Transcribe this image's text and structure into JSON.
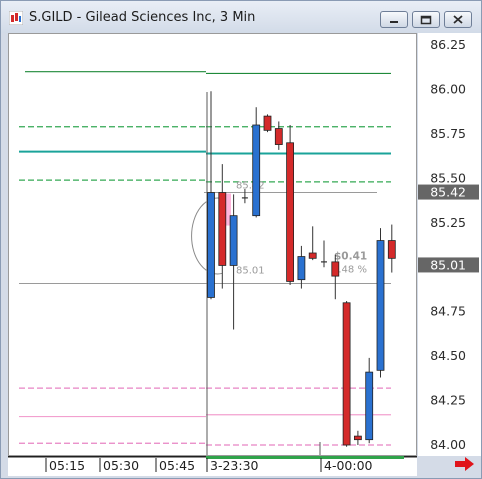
{
  "window": {
    "title": "S.GILD - Gilead Sciences Inc, 3 Min",
    "buttons": [
      "minimize",
      "restore",
      "close"
    ]
  },
  "chart_data": {
    "type": "candlestick",
    "symbol": "S.GILD",
    "interval": "3 Min",
    "y_ticks": [
      "86.25",
      "86.00",
      "85.75",
      "85.50",
      "85.25",
      "85.00",
      "84.75",
      "84.50",
      "84.25",
      "84.00"
    ],
    "y_tick_values": [
      86.25,
      86.0,
      85.75,
      85.5,
      85.25,
      85.0,
      84.75,
      84.5,
      84.25,
      84.0
    ],
    "x_ticks": [
      "05:15",
      "05:30",
      "05:45",
      "3-23:30",
      "4-00:00"
    ],
    "price_tags": [
      {
        "label": "85.42",
        "value": 85.42
      },
      {
        "label": "85.01",
        "value": 85.01
      }
    ],
    "measure": {
      "high_label": "85.42",
      "low_label": "85.01",
      "change_label": "$0.41",
      "pct_label": "0.48 %"
    },
    "candles": [
      {
        "o": 84.83,
        "h": 85.99,
        "l": 84.82,
        "c": 85.42,
        "dir": "up"
      },
      {
        "o": 85.42,
        "h": 85.58,
        "l": 84.88,
        "c": 85.01,
        "dir": "down"
      },
      {
        "o": 85.01,
        "h": 85.41,
        "l": 84.65,
        "c": 85.29,
        "dir": "up"
      },
      {
        "o": 85.39,
        "h": 85.44,
        "l": 85.36,
        "c": 85.39,
        "dir": "flat"
      },
      {
        "o": 85.29,
        "h": 85.9,
        "l": 85.28,
        "c": 85.8,
        "dir": "up"
      },
      {
        "o": 85.85,
        "h": 85.86,
        "l": 85.76,
        "c": 85.77,
        "dir": "down"
      },
      {
        "o": 85.78,
        "h": 85.82,
        "l": 85.66,
        "c": 85.69,
        "dir": "down"
      },
      {
        "o": 85.7,
        "h": 85.8,
        "l": 84.9,
        "c": 84.92,
        "dir": "down"
      },
      {
        "o": 84.93,
        "h": 85.12,
        "l": 84.88,
        "c": 85.06,
        "dir": "up"
      },
      {
        "o": 85.08,
        "h": 85.23,
        "l": 85.04,
        "c": 85.05,
        "dir": "down"
      },
      {
        "o": 85.03,
        "h": 85.15,
        "l": 85.0,
        "c": 85.03,
        "dir": "flat"
      },
      {
        "o": 85.03,
        "h": 85.07,
        "l": 84.82,
        "c": 84.95,
        "dir": "down"
      },
      {
        "o": 84.8,
        "h": 84.81,
        "l": 83.99,
        "c": 84.0,
        "dir": "down"
      },
      {
        "o": 84.05,
        "h": 84.08,
        "l": 84.0,
        "c": 84.03,
        "dir": "down"
      },
      {
        "o": 84.03,
        "h": 84.49,
        "l": 84.01,
        "c": 84.41,
        "dir": "up"
      },
      {
        "o": 84.42,
        "h": 85.22,
        "l": 84.38,
        "c": 85.15,
        "dir": "up"
      },
      {
        "o": 85.15,
        "h": 85.24,
        "l": 84.97,
        "c": 85.05,
        "dir": "down"
      }
    ],
    "levels": [
      {
        "kind": "solid",
        "color": "#1f8a3a",
        "left": 86.1,
        "right": 86.09
      },
      {
        "kind": "dash",
        "color": "#33a853",
        "left": 85.79,
        "right": 85.79
      },
      {
        "kind": "solid",
        "color": "#1aa39a",
        "left": 85.65,
        "right": 85.64
      },
      {
        "kind": "dash",
        "color": "#33a853",
        "left": 85.49,
        "right": 85.48
      },
      {
        "kind": "dash",
        "color": "#e783c4",
        "left": 84.32,
        "right": 84.32
      },
      {
        "kind": "solid",
        "color": "#f2a0cf",
        "left": 84.16,
        "right": 84.17
      },
      {
        "kind": "dash",
        "color": "#e783c4",
        "left": 84.01,
        "right": 84.0
      }
    ]
  },
  "colors": {
    "up": "#2a71d0",
    "down": "#d42a2a",
    "tag_bg": "#666666",
    "session_bar": "#2fa34a",
    "arrow": "#e0141b"
  },
  "icons": {
    "app": "chart-app-icon",
    "scroll": "scroll-right-arrow-icon"
  }
}
